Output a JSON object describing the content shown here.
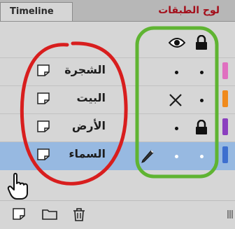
{
  "panel": {
    "tab_label": "Timeline",
    "annotation_title": "لوح الطبقات",
    "header_icons": [
      "eye-icon",
      "lock-icon"
    ]
  },
  "layers": [
    {
      "name": "الشجرة",
      "visibility": "shown",
      "lock": "unlocked",
      "color": "#e070c0",
      "selected": false
    },
    {
      "name": "البيت",
      "visibility": "hidden",
      "lock": "unlocked",
      "color": "#f08a1c",
      "selected": false
    },
    {
      "name": "الأرض",
      "visibility": "shown",
      "lock": "locked",
      "color": "#8b3fbf",
      "selected": false
    },
    {
      "name": "السماء",
      "visibility": "shown",
      "lock": "unlocked",
      "color": "#3d6fcf",
      "selected": true,
      "edit_icon": "pencil-icon"
    }
  ],
  "bottom_toolbar": {
    "icons": [
      "new-layer-icon",
      "new-folder-icon",
      "trash-icon"
    ]
  },
  "annotations": {
    "red_oval": "#d81e1e",
    "green_rect": "#5fb432",
    "cursor": "hand-pointer-icon"
  },
  "colors": {
    "panel_bg": "#d6d6d6",
    "selected_row": "#97b9e1",
    "tab_bg": "#b7b7b7"
  }
}
